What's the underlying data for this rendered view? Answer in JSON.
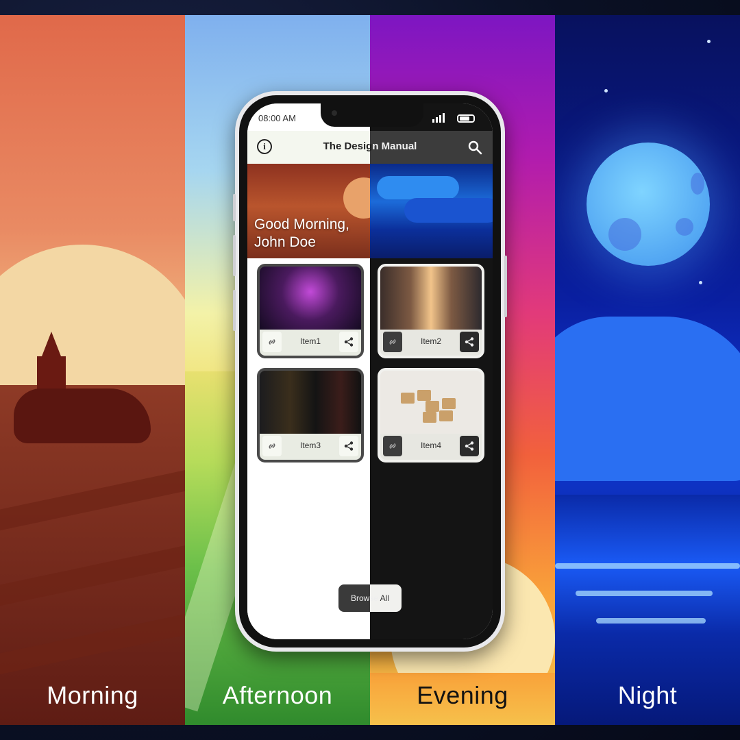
{
  "panels": [
    {
      "label": "Morning"
    },
    {
      "label": "Afternoon"
    },
    {
      "label": "Evening"
    },
    {
      "label": "Night"
    }
  ],
  "status": {
    "time": "08:00 AM"
  },
  "app": {
    "title_left": "The Desig",
    "title_right": "n Manual",
    "info_icon": "info-icon",
    "search_icon": "search-icon"
  },
  "hero": {
    "greeting": "Good Morning,\nJohn Doe"
  },
  "items": [
    {
      "label": "Item1"
    },
    {
      "label": "Item2"
    },
    {
      "label": "Item3"
    },
    {
      "label": "Item4"
    }
  ],
  "browse": {
    "left": "Browse",
    "right": " All"
  },
  "colors": {
    "light_bg": "#ffffff",
    "dark_bg": "#141414",
    "appbar_light": "#f4f7ef",
    "appbar_dark": "#3c3c3c"
  }
}
